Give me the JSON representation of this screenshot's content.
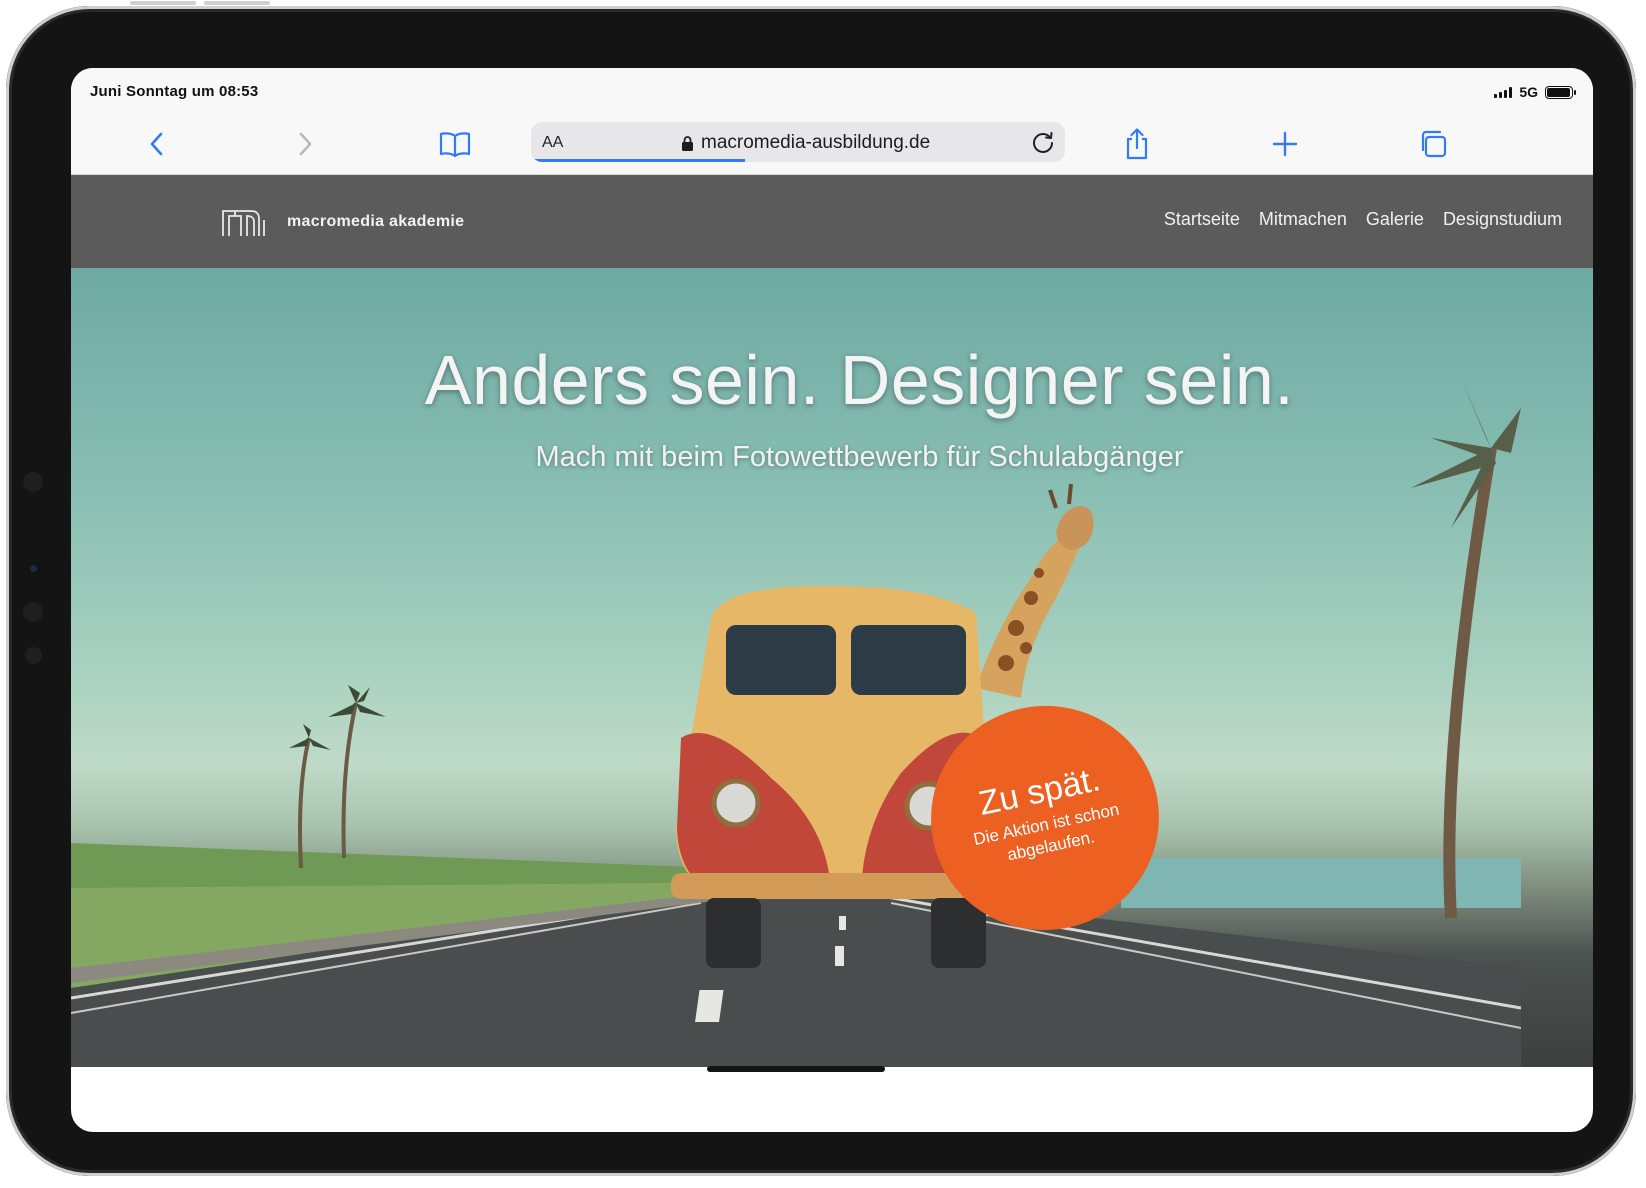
{
  "status_bar": {
    "time": "Juni Sonntag um 08:53",
    "network": "5G"
  },
  "browser": {
    "text_size_button": "AA",
    "url": "macromedia-ausbildung.de",
    "icons": [
      "back-icon",
      "forward-icon",
      "bookmarks-icon",
      "lock-icon",
      "reload-icon",
      "share-icon",
      "new-tab-icon",
      "tabs-icon"
    ],
    "accent_color": "#2f7cf6"
  },
  "site": {
    "logo_text": "macromedia akademie",
    "nav": [
      "Startseite",
      "Mitmachen",
      "Galerie",
      "Designstudium"
    ],
    "header_color": "#5b5b5b"
  },
  "hero": {
    "title": "Anders sein. Designer sein.",
    "subtitle": "Mach mit beim Fotowettbewerb für Schulabgänger",
    "badge": {
      "headline": "Zu spät.",
      "text": "Die Aktion ist schon abgelaufen.",
      "color": "#ec6122"
    }
  }
}
